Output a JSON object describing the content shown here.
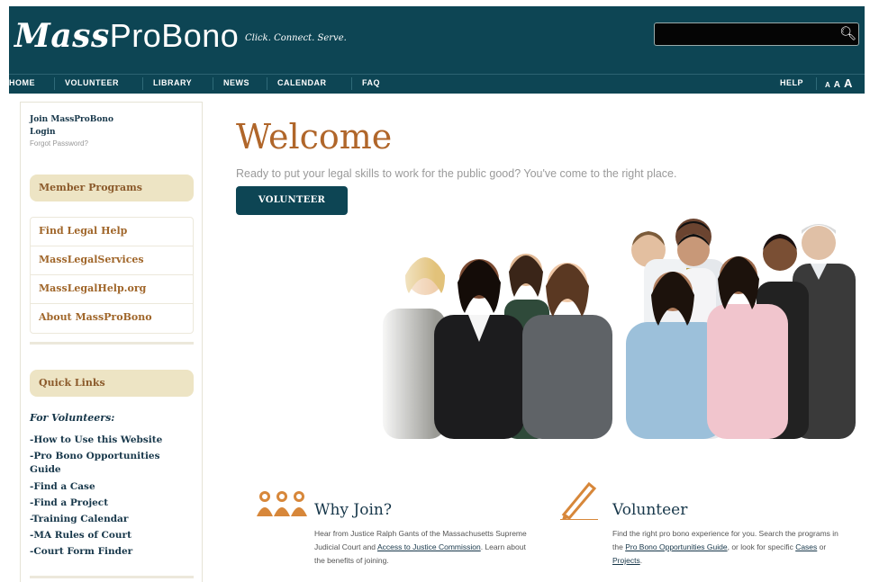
{
  "header": {
    "logo_bold": "Mass",
    "logo_regular": "ProBono",
    "tagline": "Click. Connect. Serve.",
    "search": {
      "value": "",
      "icon": "search-icon"
    }
  },
  "nav": {
    "items": [
      "HOME",
      "VOLUNTEER",
      "LIBRARY",
      "NEWS",
      "CALENDAR",
      "FAQ"
    ],
    "help": "HELP",
    "font_sizes": [
      "A",
      "A",
      "A"
    ]
  },
  "sidebar": {
    "join": "Join MassProBono",
    "login": "Login",
    "forgot": "Forgot Password?",
    "member_programs": "Member Programs",
    "menu": [
      "Find Legal Help",
      "MassLegalServices",
      "MassLegalHelp.org",
      "About MassProBono"
    ],
    "quick_links": "Quick Links",
    "for_volunteers": "For Volunteers:",
    "links": [
      "-How to Use this Website",
      "-Pro Bono Opportunities Guide",
      "-Find a Case",
      "-Find a Project",
      "-Training Calendar",
      "-MA Rules of Court",
      "-Court Form Finder"
    ]
  },
  "main": {
    "title": "Welcome",
    "intro": "Ready to put your legal skills to work for the public good? You've come to the right place.",
    "volunteer_button": "VOLUNTEER",
    "why_join": {
      "title": "Why Join?",
      "text_1": "Hear from Justice Ralph Gants of the Massachusetts Supreme Judicial Court and ",
      "link_1": "Access to Justice Commission",
      "text_2": ". Learn about the benefits of joining."
    },
    "volunteer": {
      "title": "Volunteer",
      "text_1": "Find the right pro bono experience for you. Search the programs in the ",
      "link_1": "Pro Bono Opportunities Guide",
      "text_2": ", or look for specific ",
      "link_2": "Cases",
      "text_3": " or ",
      "link_3": "Projects",
      "text_4": "."
    }
  },
  "colors": {
    "header": "#0d4554",
    "accent": "#b0662a",
    "pill": "#ede4c4",
    "link": "#17374a"
  }
}
